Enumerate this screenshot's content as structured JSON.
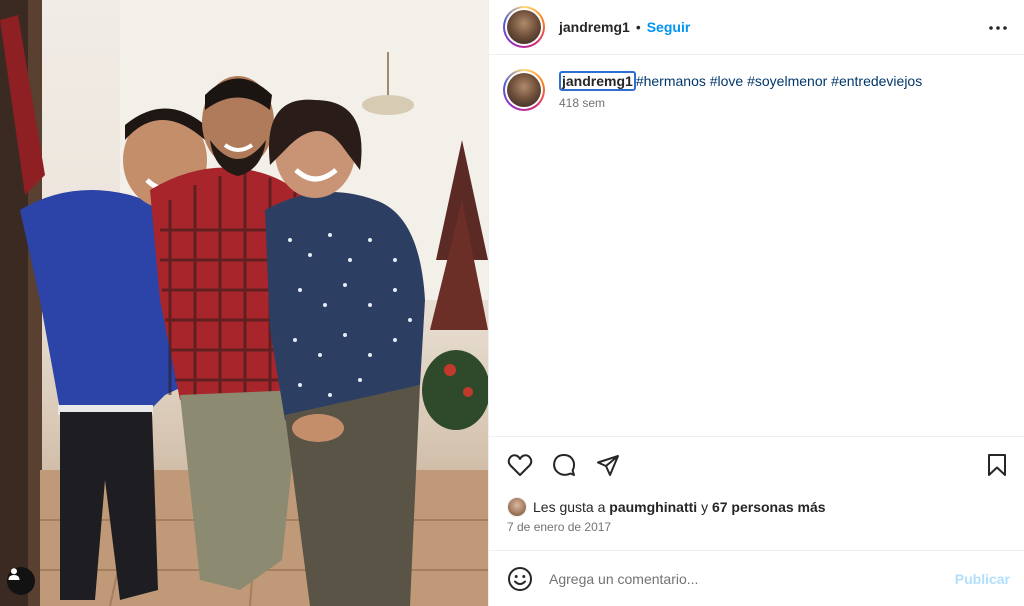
{
  "post": {
    "username": "jandremg1",
    "separator": "•",
    "follow_label": "Seguir",
    "more_icon": "more-horizontal-icon",
    "caption": {
      "username": "jandremg1",
      "hashtags": [
        "#hermanos",
        "#love",
        "#soyelmenor",
        "#entredeviejos"
      ],
      "time_ago": "418 sem"
    },
    "likes": {
      "prefix": "Les gusta a",
      "liked_by": "paumghinatti",
      "connector": "y",
      "others": "67 personas más"
    },
    "date": "7 de enero de 2017",
    "comment": {
      "placeholder": "Agrega un comentario...",
      "value": "",
      "publish_label": "Publicar"
    }
  },
  "icons": {
    "like": "heart-icon",
    "comment": "comment-icon",
    "share": "send-icon",
    "save": "bookmark-icon",
    "emoji": "emoji-icon",
    "user_tag": "user-icon"
  },
  "colors": {
    "accent": "#0095f6",
    "hashtag": "#00376b",
    "publish_disabled": "#b2dffc",
    "muted": "#737373"
  }
}
